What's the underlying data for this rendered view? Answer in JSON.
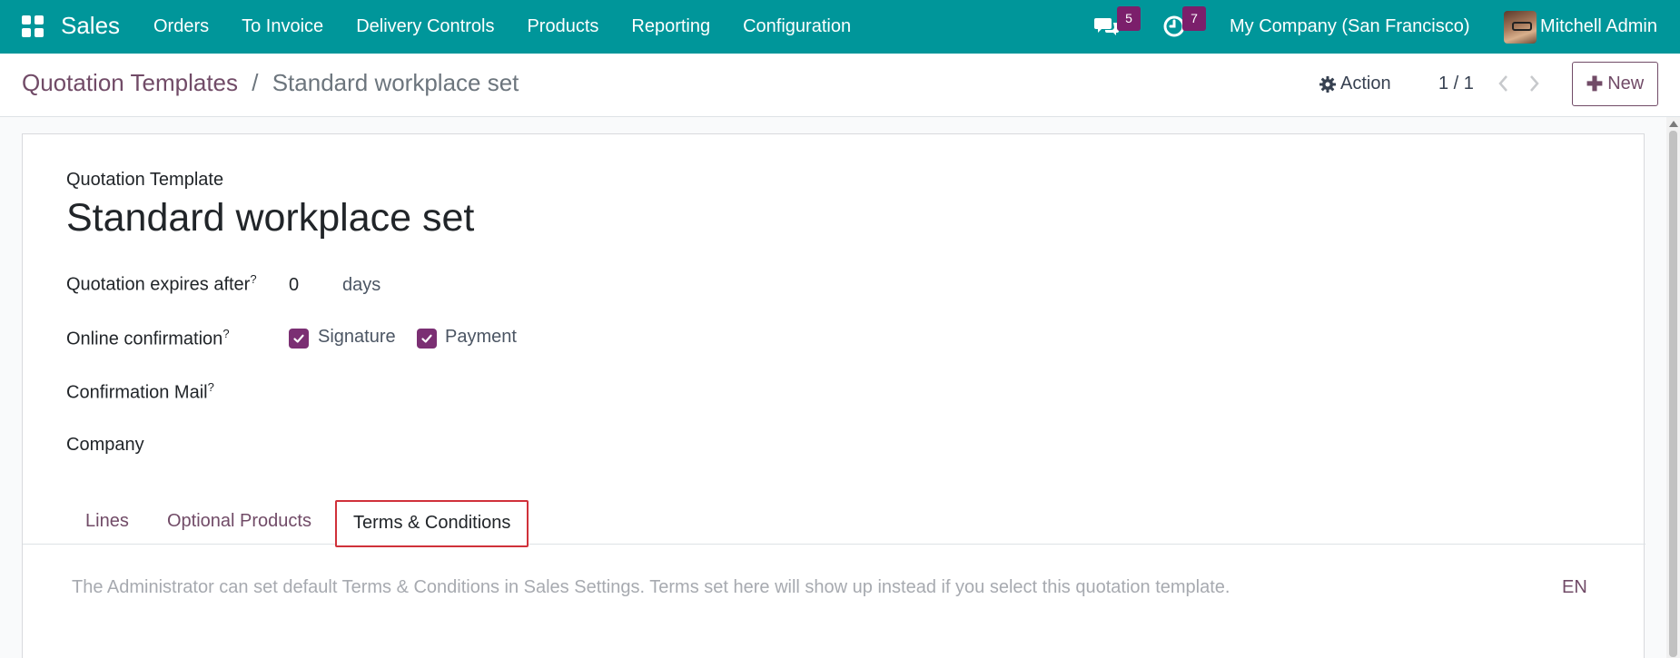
{
  "navbar": {
    "app_name": "Sales",
    "menu": [
      "Orders",
      "To Invoice",
      "Delivery Controls",
      "Products",
      "Reporting",
      "Configuration"
    ],
    "messages_count": "5",
    "activities_count": "7",
    "company": "My Company (San Francisco)",
    "user_name": "Mitchell Admin",
    "icons": [
      "apps-grid-icon",
      "chat-bubbles-icon",
      "clock-icon"
    ],
    "colors": {
      "bar": "#00969a",
      "badge": "#7b1f6b"
    }
  },
  "control_panel": {
    "breadcrumb_parent": "Quotation Templates",
    "breadcrumb_separator": "/",
    "breadcrumb_current": "Standard workplace set",
    "action_label": "Action",
    "pager_value": "1 / 1",
    "new_label": "New",
    "accent_color": "#714b67"
  },
  "form": {
    "template_label": "Quotation Template",
    "template_name": "Standard workplace set",
    "expires_label": "Quotation expires after",
    "expires_value": "0",
    "expires_unit": "days",
    "online_confirmation_label": "Online confirmation",
    "signature_label": "Signature",
    "signature_checked": true,
    "payment_label": "Payment",
    "payment_checked": true,
    "confirmation_mail_label": "Confirmation Mail",
    "company_label": "Company",
    "help_mark": "?"
  },
  "tabs": {
    "lines": "Lines",
    "optional_products": "Optional Products",
    "terms": "Terms & Conditions",
    "active": "Terms & Conditions"
  },
  "terms": {
    "placeholder": "The Administrator can set default Terms & Conditions in Sales Settings. Terms set here will show up instead if you select this quotation template.",
    "language": "EN"
  }
}
